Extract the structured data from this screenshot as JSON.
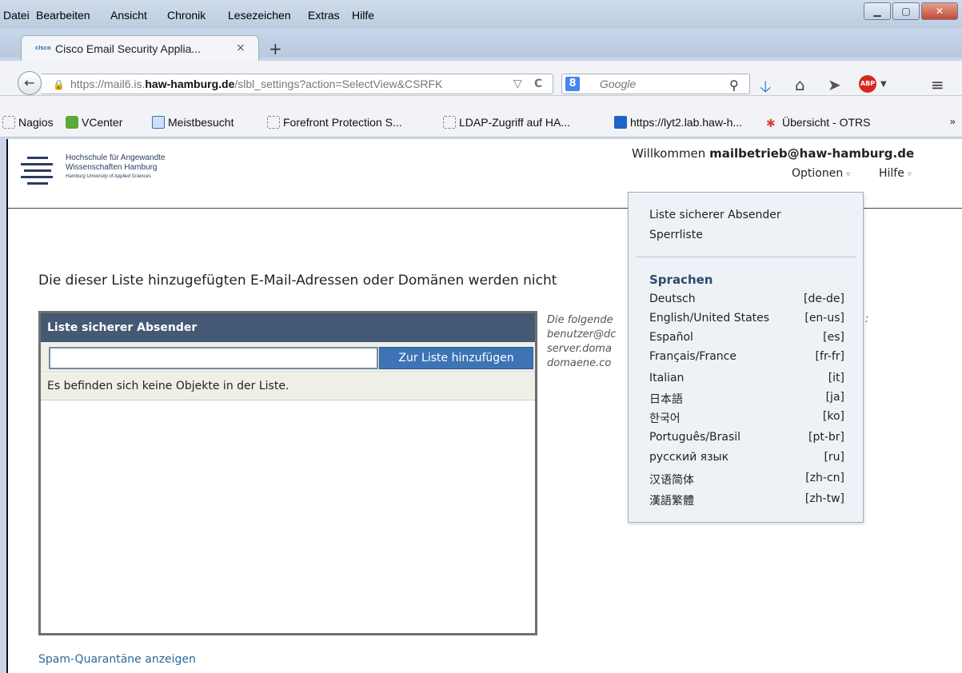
{
  "browser": {
    "menu": [
      "Datei",
      "Bearbeiten",
      "Ansicht",
      "Chronik",
      "Lesezeichen",
      "Extras",
      "Hilfe"
    ],
    "window_controls": {
      "minimize": "▁",
      "maximize": "▢",
      "close": "✕"
    },
    "tab": {
      "favicon": "cisco",
      "title": "Cisco Email Security Applia...",
      "close": "×"
    },
    "new_tab": "+",
    "url": {
      "prefix": "https://mail6.is.",
      "domain": "haw-hamburg.de",
      "path": "/slbl_settings?action=SelectView&CSRFK",
      "dropdown": "▽",
      "reload": "C"
    },
    "search": {
      "engine_icon": "8",
      "placeholder": "Google"
    },
    "bookmarks": [
      {
        "label": "Nagios",
        "icon": "blank-page-icon"
      },
      {
        "label": "VCenter",
        "icon": "vcenter-icon"
      },
      {
        "label": "Meistbesucht",
        "icon": "most-visited-icon"
      },
      {
        "label": "Forefront Protection S...",
        "icon": "blank-page-icon"
      },
      {
        "label": "LDAP-Zugriff auf HA...",
        "icon": "blank-page-icon"
      },
      {
        "label": "https://lyt2.lab.haw-h...",
        "icon": "outlook-icon"
      },
      {
        "label": "Übersicht - OTRS",
        "icon": "otrs-icon"
      }
    ],
    "bookmarks_overflow": "»"
  },
  "header": {
    "logo": {
      "line1": "Hochschule für Angewandte",
      "line2": "Wissenschaften Hamburg",
      "line3": "Hamburg University of Applied Sciences"
    },
    "welcome_prefix": "Willkommen",
    "user": "mailbetrieb@haw-hamburg.de",
    "options": "Optionen",
    "help": "Hilfe"
  },
  "main": {
    "intro": "Die dieser Liste hinzugefügten E-Mail-Adressen oder Domänen werden nicht",
    "panel": {
      "title": "Liste sicherer Absender",
      "input_value": "",
      "add_button": "Zur Liste hinzufügen",
      "empty_message": "Es befinden sich keine Objekte in der Liste."
    },
    "hint_lines": [
      "Die folgende",
      "benutzer@dc",
      "server.doma",
      "domaene.co"
    ],
    "hint_tail": ":",
    "footer_link": "Spam-Quarantäne anzeigen"
  },
  "dropdown": {
    "items": [
      "Liste sicherer Absender",
      "Sperrliste"
    ],
    "languages_title": "Sprachen",
    "languages": [
      {
        "name": "Deutsch",
        "code": "[de-de]"
      },
      {
        "name": "English/United States",
        "code": "[en-us]"
      },
      {
        "name": "Español",
        "code": "[es]"
      },
      {
        "name": "Français/France",
        "code": "[fr-fr]"
      },
      {
        "name": "Italian",
        "code": "[it]"
      },
      {
        "name": "日本語",
        "code": "[ja]"
      },
      {
        "name": "한국어",
        "code": "[ko]"
      },
      {
        "name": "Português/Brasil",
        "code": "[pt-br]"
      },
      {
        "name": "русский язык",
        "code": "[ru]"
      },
      {
        "name": "汉语简体",
        "code": "[zh-cn]"
      },
      {
        "name": "漢語繁體",
        "code": "[zh-tw]"
      }
    ]
  }
}
